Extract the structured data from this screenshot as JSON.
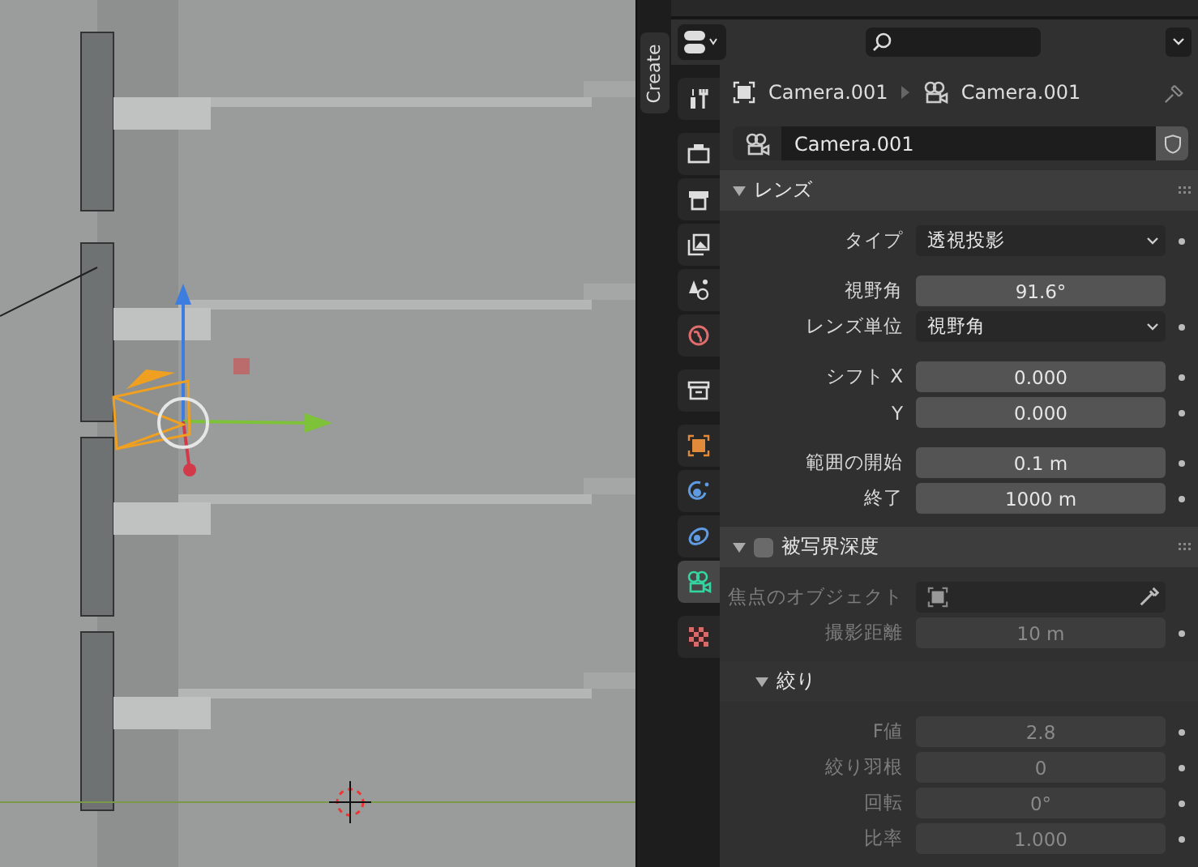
{
  "sidebar_tabs": [
    {
      "label": "Create"
    }
  ],
  "properties": {
    "tab_groups": [
      [
        {
          "kind": "tool",
          "selected": false
        }
      ],
      [
        {
          "kind": "render",
          "selected": false
        },
        {
          "kind": "output",
          "selected": false
        },
        {
          "kind": "view_layer",
          "selected": false
        },
        {
          "kind": "scene",
          "selected": false
        },
        {
          "kind": "world",
          "selected": false
        }
      ],
      [
        {
          "kind": "collection",
          "selected": false
        }
      ],
      [
        {
          "kind": "object",
          "selected": false
        },
        {
          "kind": "modifiers",
          "selected": false
        },
        {
          "kind": "physics",
          "selected": false
        },
        {
          "kind": "camera",
          "selected": true
        }
      ],
      [
        {
          "kind": "texture",
          "selected": false
        }
      ]
    ],
    "breadcrumb": [
      "Camera.001",
      "Camera.001"
    ],
    "datablock": "Camera.001",
    "panels": [
      {
        "title": "レンズ",
        "expanded": true,
        "groups": [
          [
            {
              "kind": "dropdown",
              "label": "タイプ",
              "value": "透視投影",
              "dot": true,
              "disabled": false
            }
          ],
          [
            {
              "kind": "number",
              "label": "視野角",
              "value": "91.6°",
              "dot": false,
              "disabled": false
            },
            {
              "kind": "dropdown",
              "label": "レンズ単位",
              "value": "視野角",
              "dot": true,
              "disabled": false
            }
          ],
          [
            {
              "kind": "number",
              "label": "シフト X",
              "value": "0.000",
              "dot": true,
              "disabled": false
            },
            {
              "kind": "number",
              "label": "Y",
              "value": "0.000",
              "dot": true,
              "disabled": false
            }
          ],
          [
            {
              "kind": "number",
              "label": "範囲の開始",
              "value": "0.1 m",
              "dot": true,
              "disabled": false
            },
            {
              "kind": "number",
              "label": "終了",
              "value": "1000 m",
              "dot": true,
              "disabled": false
            }
          ]
        ]
      },
      {
        "title": "被写界深度",
        "expanded": true,
        "checked": false,
        "groups": [
          [
            {
              "kind": "object",
              "label": "焦点のオブジェクト",
              "dot": false,
              "disabled": true
            },
            {
              "kind": "number",
              "label": "撮影距離",
              "value": "10 m",
              "dot": true,
              "disabled": true
            }
          ]
        ],
        "subpanel": {
          "title": "絞り",
          "expanded": true,
          "groups": [
            [
              {
                "kind": "number",
                "label": "F値",
                "value": "2.8",
                "dot": true,
                "disabled": true
              },
              {
                "kind": "number",
                "label": "絞り羽根",
                "value": "0",
                "dot": true,
                "disabled": true
              },
              {
                "kind": "number",
                "label": "回転",
                "value": "0°",
                "dot": true,
                "disabled": true
              },
              {
                "kind": "number",
                "label": "比率",
                "value": "1.000",
                "dot": true,
                "disabled": true
              }
            ]
          ]
        }
      }
    ]
  }
}
